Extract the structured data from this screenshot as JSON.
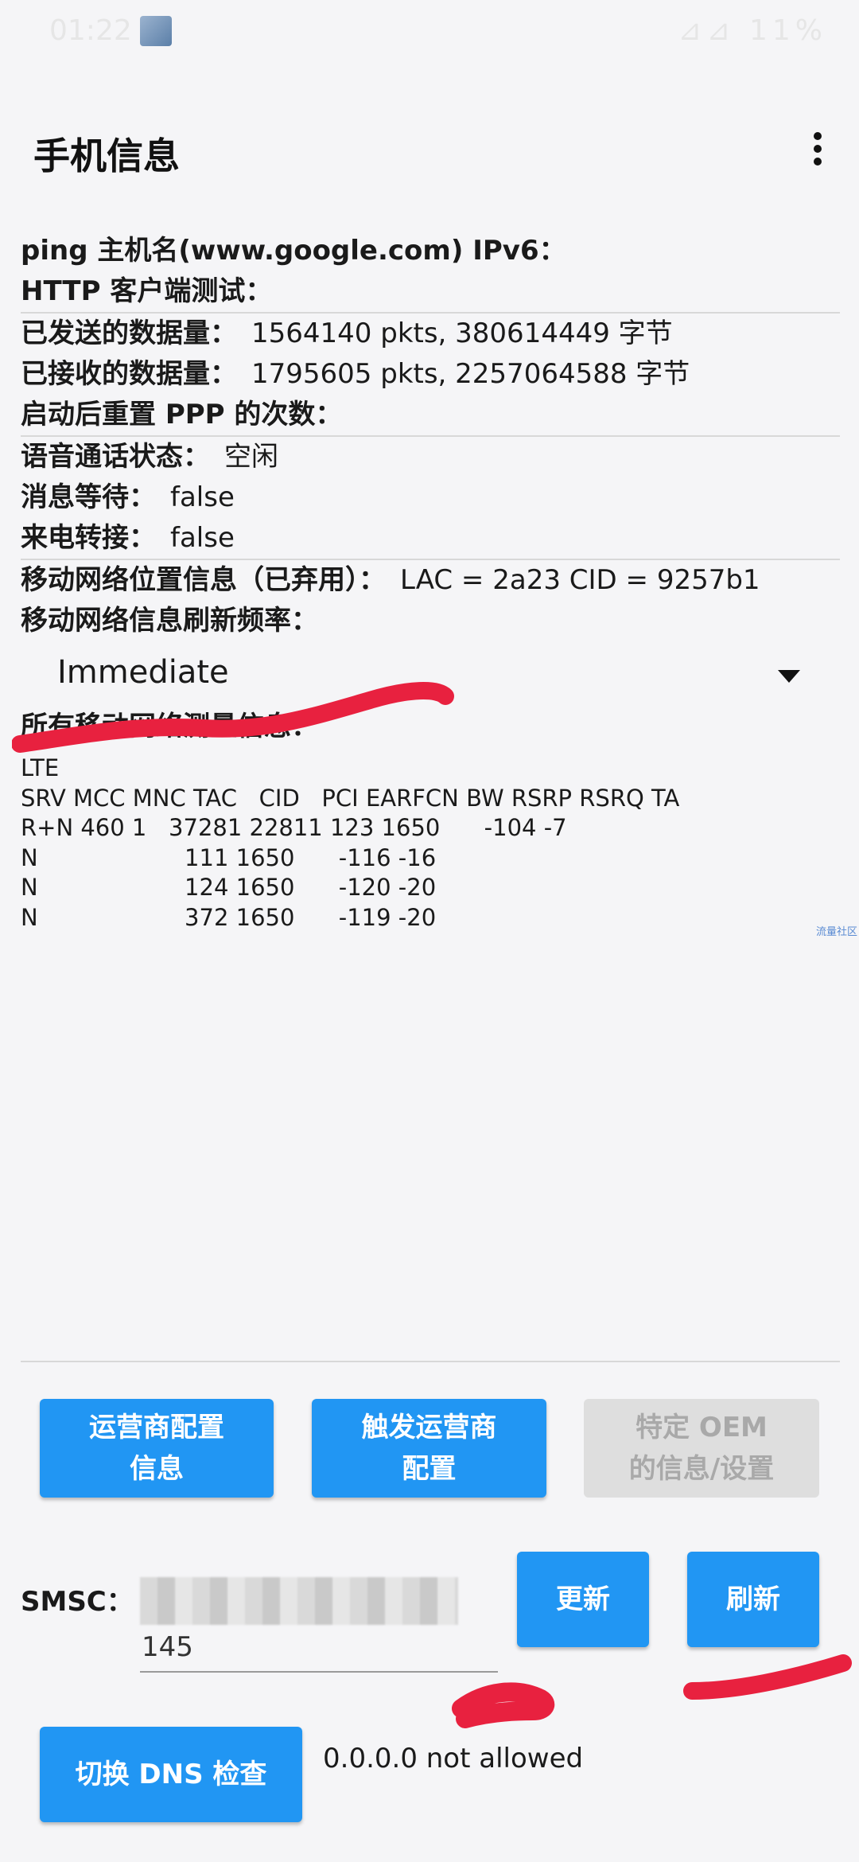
{
  "status_bar": {
    "time": "01:22",
    "battery": "11%"
  },
  "app": {
    "title": "手机信息"
  },
  "info": {
    "ping_host_ipv6_label": "ping 主机名(www.google.com) IPv6：",
    "http_client_test_label": "HTTP 客户端测试：",
    "data_sent_label": "已发送的数据量：",
    "data_sent_value": "1564140 pkts, 380614449 字节",
    "data_received_label": "已接收的数据量：",
    "data_received_value": "1795605 pkts, 2257064588 字节",
    "ppp_reset_label": "启动后重置 PPP 的次数：",
    "voice_call_label": "语音通话状态：",
    "voice_call_value": "空闲",
    "message_waiting_label": "消息等待：",
    "message_waiting_value": "false",
    "call_forward_label": "来电转接：",
    "call_forward_value": "false",
    "cell_location_label": "移动网络位置信息（已弃用）：",
    "cell_location_value": "LAC = 2a23   CID = 9257b1",
    "refresh_rate_label": "移动网络信息刷新频率：",
    "refresh_rate_value": "Immediate",
    "all_cell_info_label": "所有移动网络测量信息："
  },
  "cell_table": {
    "tech": "LTE",
    "header": "SRV MCC MNC TAC   CID   PCI EARFCN BW RSRP RSRQ TA",
    "rows": [
      "R+N 460 1   37281 22811 123 1650      -104 -7",
      "N                    111 1650      -116 -16",
      "N                    124 1650      -120 -20",
      "N                    372 1650      -119 -20"
    ]
  },
  "watermark": "流量社区",
  "buttons": {
    "carrier_config": "运营商配置\n信息",
    "trigger_carrier": "触发运营商\n配置",
    "oem_info": "特定 OEM\n的信息/设置",
    "update": "更新",
    "refresh": "刷新",
    "toggle_dns": "切换 DNS 检查"
  },
  "smsc": {
    "label": "SMSC：",
    "value_tail": "145"
  },
  "dns_status": "0.0.0.0 not allowed",
  "colors": {
    "primary": "#2196f3",
    "disabled": "#dedede",
    "scribble": "#e8213f"
  }
}
